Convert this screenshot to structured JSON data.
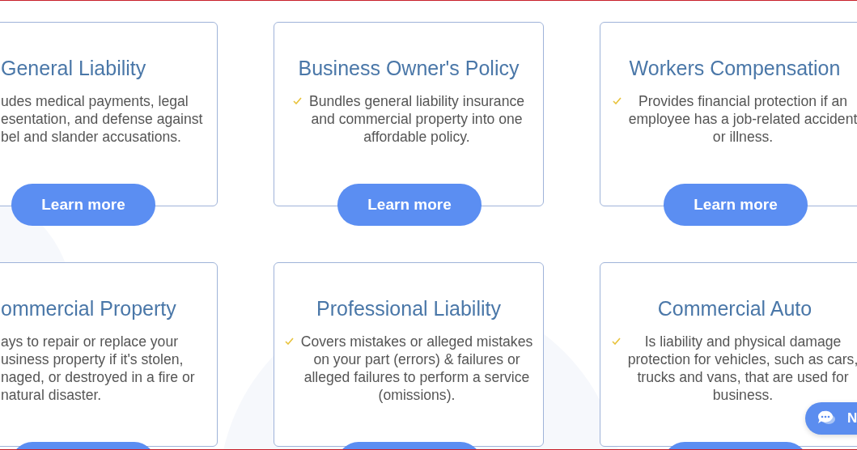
{
  "cards": [
    {
      "title": "General Liability",
      "check": false,
      "cut": true,
      "lines": [
        "udes medical payments, legal",
        "esentation, and defense against",
        "bel and slander accusations."
      ],
      "button": {
        "kind": "full",
        "label": "Learn more"
      }
    },
    {
      "title": "Business Owner's Policy",
      "check": true,
      "cut": false,
      "lines": [
        "Bundles general liability insurance",
        "and commercial property into one",
        "affordable policy."
      ],
      "button": {
        "kind": "full",
        "label": "Learn more"
      }
    },
    {
      "title": "Workers Compensation",
      "check": true,
      "cut": false,
      "lines": [
        "Provides financial protection if an",
        "employee has a job-related accident",
        "or illness."
      ],
      "button": {
        "kind": "full",
        "label": "Learn more"
      }
    },
    {
      "title": "ommercial Property",
      "check": false,
      "cut": true,
      "lines": [
        "ays to repair or replace your",
        "usiness property if it's stolen,",
        "naged, or destroyed in a fire or",
        "natural disaster."
      ],
      "button": {
        "kind": "cut"
      }
    },
    {
      "title": "Professional Liability",
      "check": true,
      "cut": false,
      "lines": [
        "Covers mistakes or alleged mistakes",
        "on your part (errors) & failures or",
        "alleged failures to perform a service",
        "(omissions)."
      ],
      "button": {
        "kind": "cut"
      }
    },
    {
      "title": "Commercial Auto",
      "check": true,
      "cut": false,
      "lines": [
        "Is liability and physical damage",
        "protection for vehicles, such as cars,",
        "trucks and vans, that are used for",
        "business."
      ],
      "button": {
        "kind": "cut"
      }
    }
  ],
  "chat": {
    "label": "N"
  }
}
